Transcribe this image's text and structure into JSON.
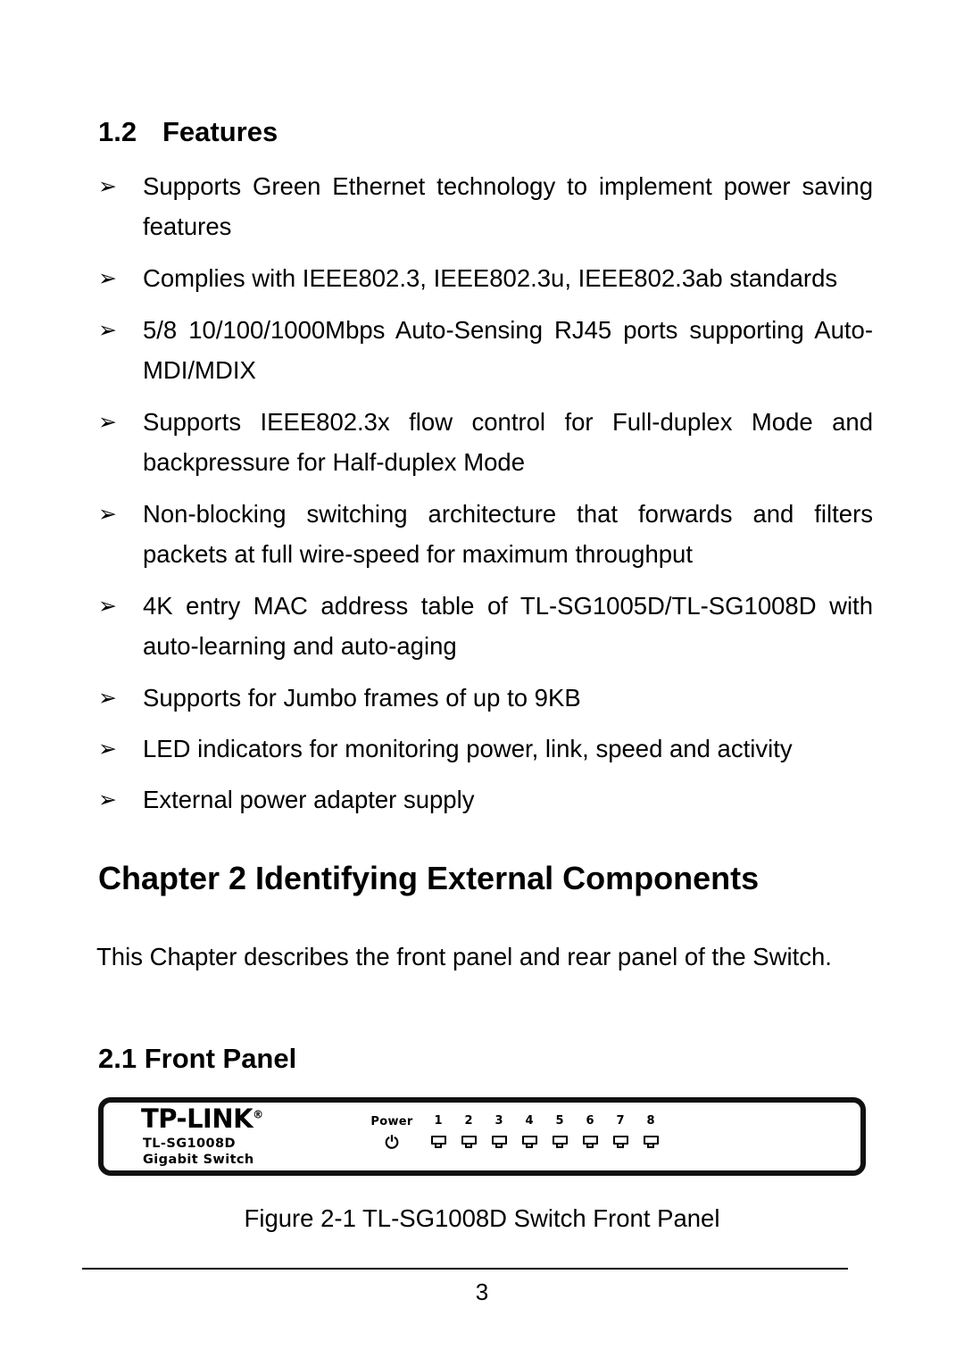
{
  "section": {
    "number": "1.2",
    "title": "Features"
  },
  "features": [
    "Supports Green Ethernet technology to implement power saving features",
    "Complies with IEEE802.3, IEEE802.3u, IEEE802.3ab standards",
    "5/8 10/100/1000Mbps Auto-Sensing RJ45 ports supporting Auto-MDI/MDIX",
    "Supports IEEE802.3x flow control for Full-duplex Mode and backpressure for Half-duplex Mode",
    "Non-blocking switching architecture that forwards and filters packets at full wire-speed for maximum throughput",
    "4K entry MAC address table of TL-SG1005D/TL-SG1008D with auto-learning and auto-aging",
    "Supports for Jumbo frames of up to 9KB",
    "LED indicators for monitoring power, link, speed and activity",
    "External power adapter supply"
  ],
  "bullet_marker": "➢",
  "chapter": {
    "heading": "Chapter 2 Identifying External Components",
    "intro": "This Chapter describes the front panel and rear panel of the Switch."
  },
  "subsection": {
    "number": "2.1",
    "title": "2.1 Front Panel"
  },
  "switch_panel": {
    "brand": "TP-LINK",
    "brand_mark": "®",
    "model": "TL-SG1008D",
    "product_type": "Gigabit Switch",
    "power_label": "Power",
    "power_glyph": "⏻",
    "ports": [
      "1",
      "2",
      "3",
      "4",
      "5",
      "6",
      "7",
      "8"
    ]
  },
  "figure_caption": "Figure 2-1 TL-SG1008D Switch Front Panel",
  "footer": {
    "page_number": "3"
  }
}
